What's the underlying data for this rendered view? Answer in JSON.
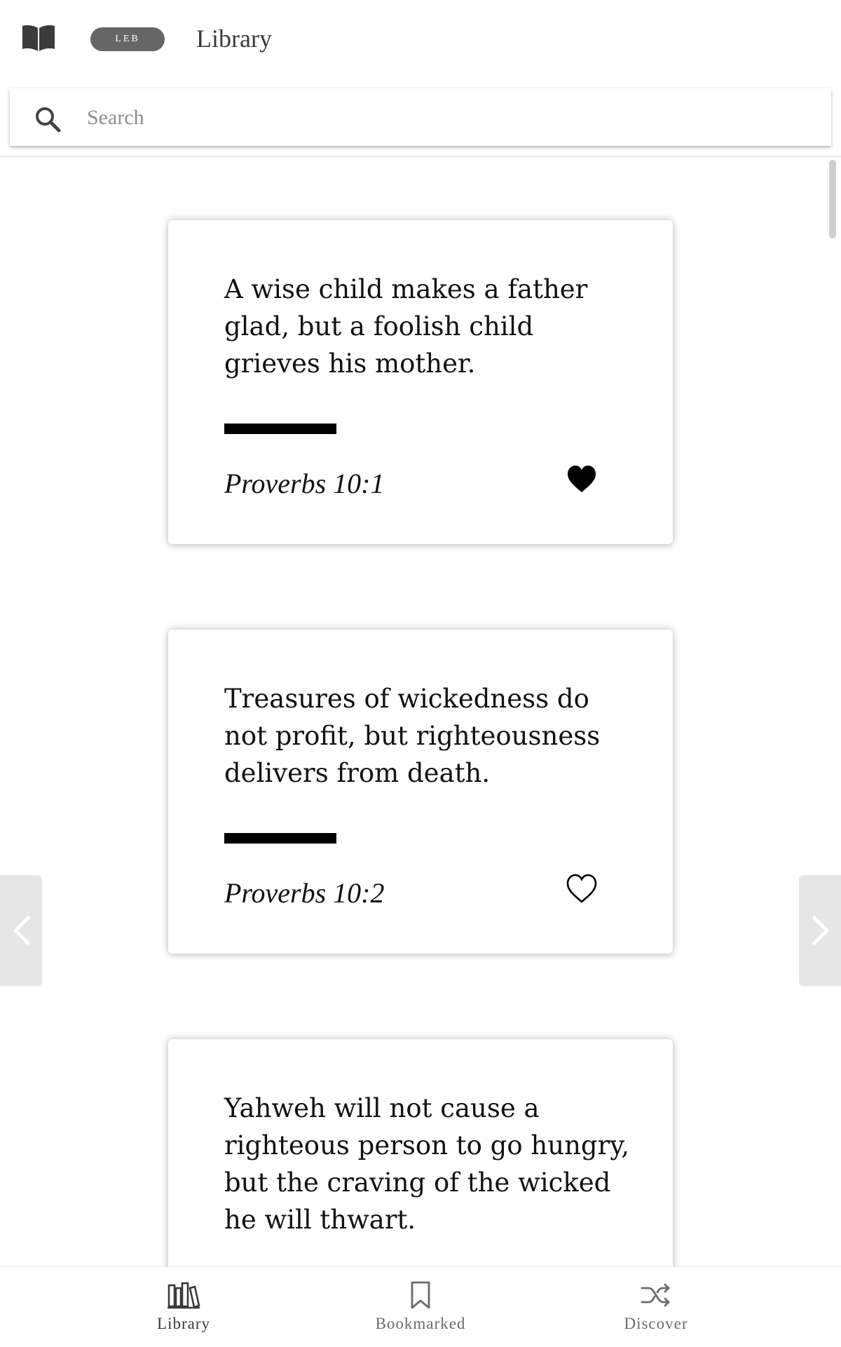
{
  "header": {
    "icon": "open-book-icon",
    "version_badge": "LEB",
    "title": "Library"
  },
  "search": {
    "icon": "search-icon",
    "placeholder": "Search",
    "value": ""
  },
  "cards": [
    {
      "text": "A wise child makes a father glad, but a foolish child grieves his mother.",
      "reference": "Proverbs 10:1",
      "favorited": true,
      "icon": "heart-filled-icon"
    },
    {
      "text": "Treasures of wickedness do not profit, but righteousness delivers from death.",
      "reference": "Proverbs 10:2",
      "favorited": false,
      "icon": "heart-outline-icon"
    },
    {
      "text": "Yahweh will not cause a righteous person to go hungry, but the craving of the wicked he will thwart.",
      "reference": "",
      "favorited": false,
      "icon": "heart-outline-icon"
    }
  ],
  "pager": {
    "prev_icon": "chevron-left-icon",
    "next_icon": "chevron-right-icon"
  },
  "bottom_nav": [
    {
      "label": "Library",
      "icon": "library-shelf-icon",
      "active": true
    },
    {
      "label": "Bookmarked",
      "icon": "bookmark-icon",
      "active": false
    },
    {
      "label": "Discover",
      "icon": "shuffle-icon",
      "active": false
    }
  ],
  "colors": {
    "badge_bg": "#666666",
    "text": "#111111",
    "muted": "#8d8d8d",
    "arrow_bg": "#e6e6e6"
  }
}
